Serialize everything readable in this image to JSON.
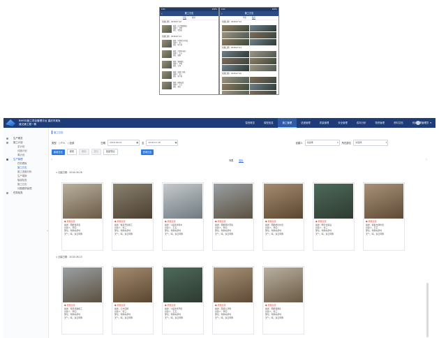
{
  "mobile": [
    {
      "status_time": "9:41",
      "status_right": "100%",
      "title": "施工日志",
      "tabs": [
        "列表",
        "图片"
      ],
      "active_tab": 0,
      "entries": [
        {
          "date": "创建日期：2018-07-22",
          "lines": [
            "描述：综合管廊基础",
            "创建人：李四",
            "部位：地铁站"
          ]
        },
        {
          "date": "创建日期：2018-07-21",
          "lines": [
            "描述：C段基坑开挖及",
            "创建人：张三",
            "部位：地下室"
          ]
        },
        {
          "date": "",
          "lines": [
            "描述：C段基坑施工",
            "创建人：王五",
            "部位：管廊"
          ]
        },
        {
          "date": "",
          "lines": [
            "描述：钢筋绑扎",
            "创建人：李四",
            "部位：主体"
          ]
        },
        {
          "date": "",
          "lines": [
            "描述：混凝土浇筑",
            "创建人：张三",
            "部位：地下室"
          ]
        },
        {
          "date": "",
          "lines": [
            "描述：模板安装",
            "创建人：王五",
            "部位：基坑"
          ]
        }
      ]
    },
    {
      "status_time": "9:41",
      "status_right": "100%",
      "title": "施工日志",
      "tabs": [
        "列表",
        "图片"
      ],
      "active_tab": 1,
      "dates": [
        "创建日期：2018-07-22",
        "创建日期：2018-07-21",
        "创建日期：2018-07-20"
      ]
    }
  ],
  "header": {
    "brand": "BIM5D施工项目管理平台 重庆市某轨道交通工程一期",
    "menu": [
      "智慧概览",
      "模型信息",
      "施工管理",
      "进度管理",
      "质量管理",
      "安全管理",
      "成本分析",
      "物资管理",
      "资料文档",
      "系统设置"
    ],
    "active_menu": 2,
    "user": "管理员"
  },
  "sidebar": [
    {
      "label": "生产概览",
      "level": 0,
      "on": false
    },
    {
      "label": "施工计划",
      "level": 0,
      "on": false
    },
    {
      "label": "总计划",
      "level": 2,
      "on": false
    },
    {
      "label": "月度计划",
      "level": 2,
      "on": false
    },
    {
      "label": "周计划",
      "level": 2,
      "on": false
    },
    {
      "label": "生产管理",
      "level": 0,
      "on": true
    },
    {
      "label": "任务看板",
      "level": 2,
      "on": false
    },
    {
      "label": "施工日志",
      "level": 2,
      "on": true
    },
    {
      "label": "施工进度分析",
      "level": 2,
      "on": false
    },
    {
      "label": "生产周报",
      "level": 2,
      "on": false
    },
    {
      "label": "隐患检查",
      "level": 2,
      "on": false
    },
    {
      "label": "施工日志",
      "level": 2,
      "on": false
    },
    {
      "label": "问题跟踪管理",
      "level": 2,
      "on": false
    },
    {
      "label": "任务检查",
      "level": 0,
      "on": false
    }
  ],
  "main": {
    "breadcrumb": "施工日志",
    "filter": {
      "type_label": "类型",
      "type_opts": [
        "个人",
        "全部"
      ],
      "date_label": "日期",
      "date_from": "2018-06-01",
      "date_sep": "至",
      "date_to": "2018-07-18",
      "creator_label": "创建人",
      "creator_placeholder": "请选择",
      "part_label": "所在部位",
      "part_placeholder": "请选择"
    },
    "buttons": {
      "add": "新增日志",
      "edit": "修改",
      "delete": "删除",
      "submit": "提交",
      "export": "批量导出",
      "query": "查询日志"
    },
    "view_tabs": [
      "列表",
      "图片"
    ],
    "active_view": 1,
    "sections": [
      {
        "title": "∨ 创建日期：2018-06-28",
        "cards": [
          {
            "tag": "● 质量巡查",
            "desc": "描述：钢筋笼吊装",
            "creator": "创建人：李四",
            "part": "部位：地铁站基坑",
            "weather": "天气：晴，多云转阴"
          },
          {
            "tag": "● 质量巡查",
            "desc": "描述：桩基开挖施工",
            "creator": "创建人：张三",
            "part": "部位：地铁站基坑",
            "weather": "天气：晴，多云转阴"
          },
          {
            "tag": "● 质量巡查",
            "desc": "描述：C段基坑积水",
            "creator": "创建人：王五",
            "part": "部位：地铁站基坑",
            "weather": "天气：晴，多云转阴"
          },
          {
            "tag": "● 质量巡查",
            "desc": "描述：钢筋网片安装",
            "creator": "创建人：李四",
            "part": "部位：地铁站基坑",
            "weather": "天气：晴，多云转阴"
          },
          {
            "tag": "● 质量巡查",
            "desc": "描述：钢筋绑扎检查",
            "creator": "创建人：李四",
            "part": "部位：地铁站基坑",
            "weather": "天气：晴，多云转阴"
          },
          {
            "tag": "● 质量巡查",
            "desc": "描述：脚手架搭设",
            "creator": "创建人：张三",
            "part": "部位：地铁站基坑",
            "weather": "天气：晴，多云转阴"
          },
          {
            "tag": "● 质量巡查",
            "desc": "描述：模板支撑检查",
            "creator": "创建人：王五",
            "part": "部位：地铁站基坑",
            "weather": "天气：晴，多云转阴"
          }
        ]
      },
      {
        "title": "∨ 创建日期：2018-06-15",
        "cards": [
          {
            "tag": "● 质量巡查",
            "desc": "描述：塔吊基础施工",
            "creator": "创建人：李四",
            "part": "部位：地铁站基坑",
            "weather": "天气：晴，多云转阴"
          },
          {
            "tag": "● 质量巡查",
            "desc": "描述：土方回填",
            "creator": "创建人：张三",
            "part": "部位：地铁站基坑",
            "weather": "天气：晴，多云转阴"
          },
          {
            "tag": "● 质量巡查",
            "desc": "描述：C段基坑开挖",
            "creator": "创建人：王五",
            "part": "部位：地铁站基坑",
            "weather": "天气：晴，多云转阴"
          },
          {
            "tag": "● 质量巡查",
            "desc": "描述：混凝土浇筑",
            "creator": "创建人：李四",
            "part": "部位：地铁站基坑",
            "weather": "天气：晴，多云转阴"
          },
          {
            "tag": "● 质量巡查",
            "desc": "描述：钢筋笼绑扎",
            "creator": "创建人：张三",
            "part": "部位：地铁站基坑",
            "weather": "天气：晴，多云转阴"
          }
        ]
      }
    ]
  },
  "colors": {
    "header_bg": "#1d3c78",
    "accent": "#2b7be0",
    "tag": "#e04a3b"
  }
}
